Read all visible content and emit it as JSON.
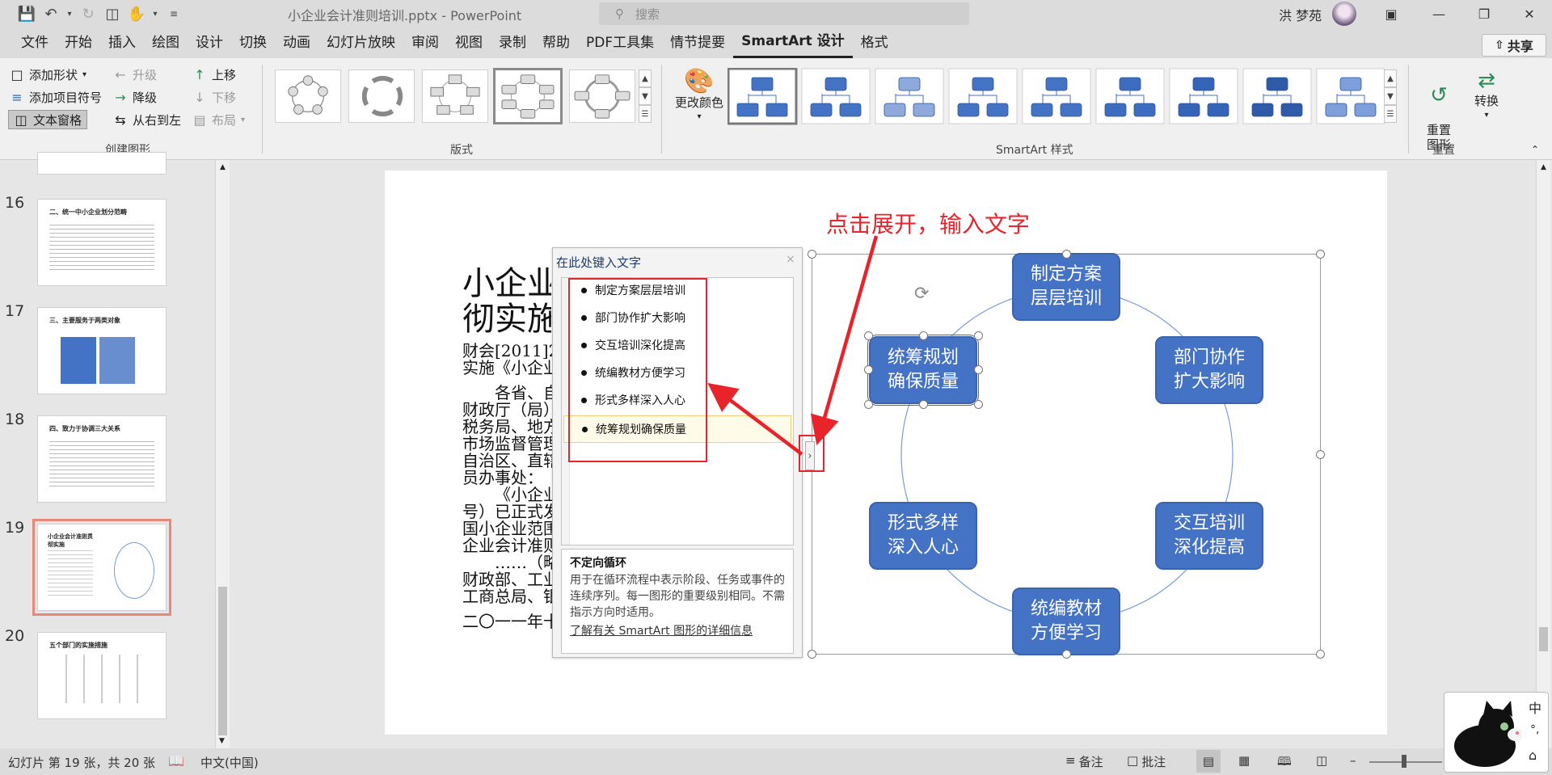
{
  "window": {
    "doc_title": "小企业会计准则培训.pptx  -  PowerPoint",
    "search_placeholder": "搜索",
    "user_name": "洪 梦苑"
  },
  "menu": {
    "items": [
      "文件",
      "开始",
      "插入",
      "绘图",
      "设计",
      "切换",
      "动画",
      "幻灯片放映",
      "审阅",
      "视图",
      "录制",
      "帮助",
      "PDF工具集",
      "情节提要",
      "SmartArt 设计",
      "格式"
    ],
    "active": "SmartArt 设计",
    "share_label": "共享"
  },
  "ribbon": {
    "create_graphic": {
      "add_shape": "添加形状",
      "add_bullet": "添加项目符号",
      "text_pane": "文本窗格",
      "promote": "升级",
      "demote": "降级",
      "right_to_left": "从右到左",
      "move_up": "上移",
      "move_down": "下移",
      "layout": "布局",
      "label": "创建图形"
    },
    "layouts_label": "版式",
    "change_colors": "更改颜色",
    "styles_label": "SmartArt 样式",
    "reset": {
      "reset_graphic": "重置\n图形",
      "convert": "转换",
      "label": "重置"
    }
  },
  "slides_panel": {
    "slides": [
      {
        "num": "16",
        "title": "二、统一中小企业划分范畴"
      },
      {
        "num": "17",
        "title": "三、主要服务于两类对象"
      },
      {
        "num": "18",
        "title": "四、致力于协调三大关系"
      },
      {
        "num": "19",
        "title": "小企业会计准则贯彻实施"
      },
      {
        "num": "20",
        "title": "五个部门的实施措施"
      }
    ],
    "selected": "19"
  },
  "slide": {
    "title_lines": [
      "小企业",
      "彻实施"
    ],
    "text_lines": [
      "财会[2011]2",
      "实施《小企业",
      "各省、自",
      "财政厅（局）",
      "税务局、地方",
      "市场监督管理",
      "自治区、直辖",
      "员办事处：",
      "《小企业",
      "号）已正式发",
      "国小企业范围",
      "企业会计准则",
      "……（略",
      "财政部、工业",
      "工商总局、银",
      "二〇一一年十"
    ],
    "annotation": "点击展开，输入文字"
  },
  "text_pane": {
    "title": "在此处键入文字",
    "close": "×",
    "items": [
      "制定方案层层培训",
      "部门协作扩大影响",
      "交互培训深化提高",
      "统编教材方便学习",
      "形式多样深入人心",
      "统筹规划确保质量"
    ],
    "info_heading": "不定向循环",
    "info_desc": "用于在循环流程中表示阶段、任务或事件的连续序列。每一图形的重要级别相同。不需指示方向时适用。",
    "info_link": "了解有关 SmartArt 图形的详细信息",
    "expand_glyph": "›"
  },
  "smartart": {
    "nodes": [
      {
        "text": "制定方案\n层层培训"
      },
      {
        "text": "部门协作\n扩大影响"
      },
      {
        "text": "交互培训\n深化提高"
      },
      {
        "text": "统编教材\n方便学习"
      },
      {
        "text": "形式多样\n深入人心"
      },
      {
        "text": "统筹规划\n确保质量"
      }
    ],
    "fill_color": "#4472c4",
    "circle_color": "#7a9bd4"
  },
  "annotation_color": "#e8232a",
  "status": {
    "slide_info": "幻灯片 第 19 张，共 20 张",
    "language": "中文(中国)",
    "notes": "备注",
    "comments": "批注"
  },
  "ime": {
    "chars": [
      "中",
      "°,",
      "⌂"
    ]
  }
}
